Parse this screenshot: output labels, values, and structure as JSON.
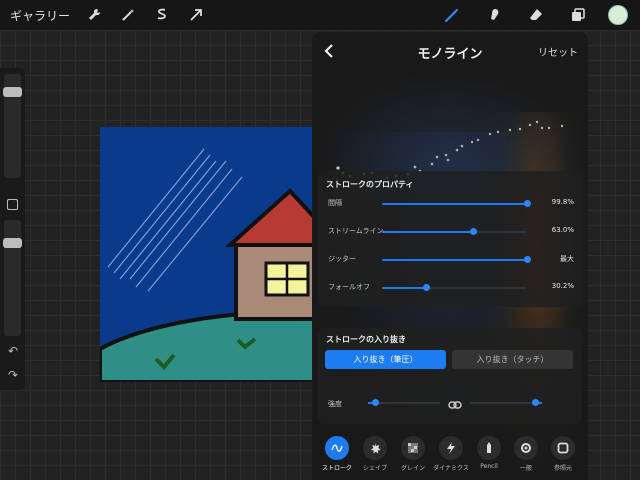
{
  "topbar": {
    "gallery_label": "ギャラリー",
    "left_tools": [
      "wrench-icon",
      "magic-wand-icon",
      "selection-icon",
      "transform-arrow-icon"
    ],
    "right_tools": [
      "brush-icon",
      "smudge-icon",
      "eraser-icon",
      "layers-icon"
    ],
    "active_tool": "brush-icon",
    "current_color": "#d6efd4"
  },
  "sidebar": {
    "brush_size_level": 0.14,
    "opacity_level": 0.17
  },
  "panel": {
    "title": "モノライン",
    "reset_label": "リセット",
    "stroke_properties": {
      "title": "ストロークのプロパティ",
      "rows": [
        {
          "label": "間隔",
          "value": "99.8%",
          "fraction": 0.998
        },
        {
          "label": "ストリームライン",
          "value": "63.0%",
          "fraction": 0.63
        },
        {
          "label": "ジッター",
          "value": "最大",
          "fraction": 1.0
        },
        {
          "label": "フォールオフ",
          "value": "30.2%",
          "fraction": 0.302
        }
      ]
    },
    "taper": {
      "title": "ストロークの入り抜き",
      "active_button": "入り抜き（筆圧）",
      "inactive_button": "入り抜き（タッチ）",
      "strength_label": "強度",
      "strength_start": 0.1,
      "strength_end": 0.9
    },
    "tabs": [
      {
        "label": "ストローク",
        "icon": "stroke-path-icon",
        "active": true
      },
      {
        "label": "シェイプ",
        "icon": "shape-icon",
        "active": false
      },
      {
        "label": "グレイン",
        "icon": "grain-icon",
        "active": false
      },
      {
        "label": "ダイナミクス",
        "icon": "dynamics-icon",
        "active": false
      },
      {
        "label": "Pencil",
        "icon": "pencil-icon",
        "active": false
      },
      {
        "label": "一般",
        "icon": "general-icon",
        "active": false
      },
      {
        "label": "参照元",
        "icon": "source-icon",
        "active": false
      }
    ]
  },
  "colors": {
    "accent": "#1e7cf2",
    "sky": "#0a3a8c",
    "hill": "#2e8f86",
    "roof": "#b83a35",
    "wall": "#a98a78",
    "window": "#f4f39b",
    "grass_mark": "#1f5a22"
  }
}
